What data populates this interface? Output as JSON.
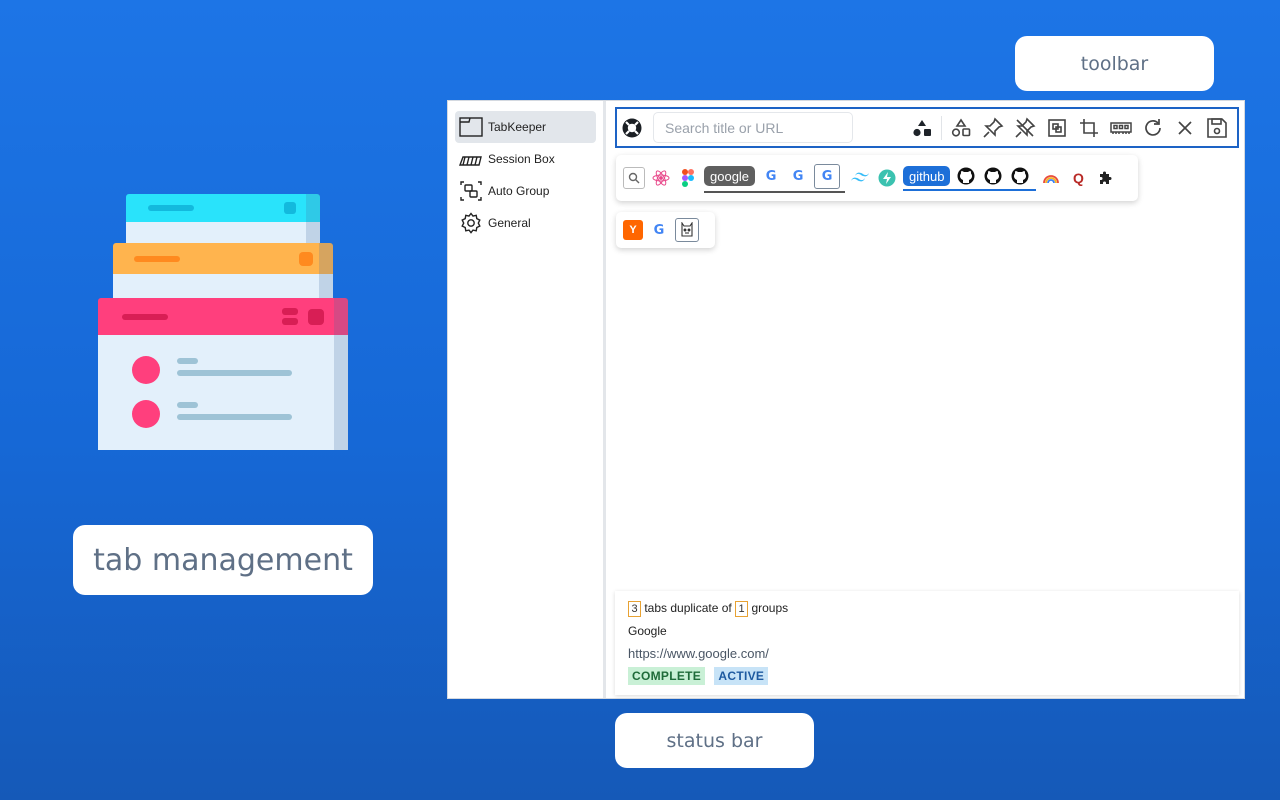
{
  "callouts": {
    "toolbar": "toolbar",
    "status_bar": "status bar",
    "tab_management": "tab management"
  },
  "sidebar": {
    "items": [
      {
        "label": "TabKeeper",
        "icon": "window-icon",
        "active": true
      },
      {
        "label": "Session Box",
        "icon": "session-box-icon",
        "active": false
      },
      {
        "label": "Auto Group",
        "icon": "auto-group-icon",
        "active": false
      },
      {
        "label": "General",
        "icon": "gear-icon",
        "active": false
      }
    ]
  },
  "toolbar": {
    "logo_icon": "lifebuoy-icon",
    "search_placeholder": "Search title or URL",
    "search_value": "",
    "buttons": [
      "shapes-filled-icon",
      "shapes-outline-icon",
      "pin-icon",
      "unpin-icon",
      "group-icon",
      "crop-icon",
      "memory-icon",
      "refresh-icon",
      "close-icon",
      "save-icon"
    ]
  },
  "tab_groups": [
    {
      "tabs": [
        {
          "kind": "favicon",
          "icon": "search-favicon-icon"
        },
        {
          "kind": "favicon",
          "icon": "react-favicon-icon"
        },
        {
          "kind": "favicon",
          "icon": "figma-favicon-icon"
        },
        {
          "kind": "chip",
          "label": "google",
          "color": "#5f5f5f"
        },
        {
          "kind": "favicon",
          "icon": "google-favicon-icon",
          "glyph": "G"
        },
        {
          "kind": "favicon",
          "icon": "google-favicon-icon",
          "glyph": "G"
        },
        {
          "kind": "favicon",
          "icon": "google-favicon-icon",
          "glyph": "G"
        },
        {
          "kind": "favicon",
          "icon": "tailwind-favicon-icon"
        },
        {
          "kind": "favicon",
          "icon": "bolt-favicon-icon"
        },
        {
          "kind": "chip",
          "label": "github",
          "color": "#1d6fd8"
        },
        {
          "kind": "favicon",
          "icon": "github-favicon-icon"
        },
        {
          "kind": "favicon",
          "icon": "github-favicon-icon"
        },
        {
          "kind": "favicon",
          "icon": "github-favicon-icon"
        },
        {
          "kind": "favicon",
          "icon": "rainbow-favicon-icon"
        },
        {
          "kind": "favicon",
          "icon": "quora-favicon-icon",
          "glyph": "Q"
        },
        {
          "kind": "favicon",
          "icon": "puzzle-extension-icon"
        }
      ]
    },
    {
      "tabs": [
        {
          "kind": "favicon",
          "icon": "ycombinator-favicon-icon",
          "glyph": "Y"
        },
        {
          "kind": "favicon",
          "icon": "google-favicon-icon",
          "glyph": "G"
        },
        {
          "kind": "favicon",
          "icon": "cat-favicon-icon"
        }
      ]
    }
  ],
  "status": {
    "tab_count": "3",
    "tabs_text": "tabs duplicate of",
    "group_count": "1",
    "groups_text": "groups",
    "title": "Google",
    "url": "https://www.google.com/",
    "tags": [
      {
        "label": "COMPLETE",
        "color": "#1f6b3a",
        "bg": "#c9f0d6"
      },
      {
        "label": "ACTIVE",
        "color": "#1e5aa0",
        "bg": "#c7e3f7"
      }
    ]
  }
}
